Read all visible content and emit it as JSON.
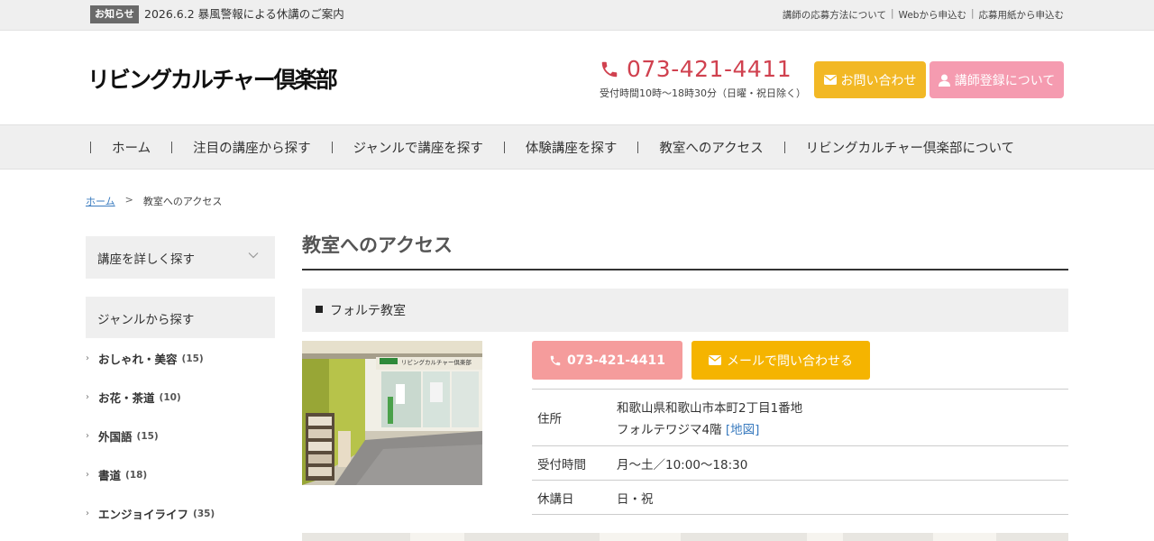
{
  "topbar": {
    "badge": "お知らせ",
    "notice": "2026.6.2 暴風警報による休講のご案内",
    "links": [
      "講師の応募方法について",
      "Webから申込む",
      "応募用紙から申込む"
    ],
    "separator": "|"
  },
  "header": {
    "logo": "リビングカルチャー倶楽部",
    "phone": "073-421-4411",
    "hours": "受付時間10時～18時30分（日曜・祝日除く）",
    "contact_button": "お問い合わせ",
    "teacher_button": "講師登録について",
    "accent_red": "#d0414f",
    "accent_yellow": "#f2b825",
    "accent_pink": "#f59bb0"
  },
  "nav": {
    "items": [
      "ホーム",
      "注目の講座から探す",
      "ジャンルで講座を探す",
      "体験講座を探す",
      "教室へのアクセス",
      "リビングカルチャー倶楽部について"
    ]
  },
  "breadcrumb": {
    "home": "ホーム",
    "separator": ">",
    "current": "教室へのアクセス"
  },
  "sidebar": {
    "search_label": "講座を詳しく探す",
    "genre_label": "ジャンルから探す",
    "genres": [
      {
        "name": "おしゃれ・美容",
        "count": "(15)"
      },
      {
        "name": "お花・茶道",
        "count": "(10)"
      },
      {
        "name": "外国語",
        "count": "(15)"
      },
      {
        "name": "書道",
        "count": "(18)"
      },
      {
        "name": "エンジョイライフ",
        "count": "(35)"
      }
    ]
  },
  "main": {
    "title": "教室へのアクセス",
    "classroom_name": "フォルテ教室",
    "tel_button": "073-421-4411",
    "mail_button": "メールで問い合わせる",
    "info": {
      "address_label": "住所",
      "address_line1": "和歌山県和歌山市本町2丁目1番地",
      "address_line2": "フォルテワジマ4階",
      "map_link": "[地図]",
      "hours_label": "受付時間",
      "hours_value": "月～土／10:00～18:30",
      "closed_label": "休講日",
      "closed_value": "日・祝"
    },
    "photo_sign": "リビングカルチャー倶楽部"
  }
}
